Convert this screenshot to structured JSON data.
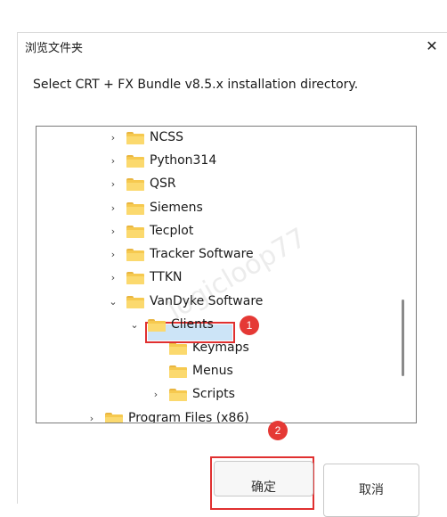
{
  "dialog": {
    "title": "浏览文件夹",
    "close_glyph": "✕",
    "description": "Select CRT + FX Bundle v8.5.x installation directory."
  },
  "tree": {
    "items": [
      {
        "label": "NCSS",
        "chevron": "›"
      },
      {
        "label": "Python314",
        "chevron": "›"
      },
      {
        "label": "QSR",
        "chevron": "›"
      },
      {
        "label": "Siemens",
        "chevron": "›"
      },
      {
        "label": "Tecplot",
        "chevron": "›"
      },
      {
        "label": "Tracker Software",
        "chevron": "›"
      },
      {
        "label": "TTKN",
        "chevron": "›"
      },
      {
        "label": "VanDyke Software",
        "chevron": "⌄"
      },
      {
        "label": "Clients",
        "chevron": "⌄"
      },
      {
        "label": "Keymaps",
        "chevron": ""
      },
      {
        "label": "Menus",
        "chevron": ""
      },
      {
        "label": "Scripts",
        "chevron": "›"
      },
      {
        "label": "Program Files (x86)",
        "chevron": "›"
      }
    ]
  },
  "badges": {
    "first": "1",
    "second": "2"
  },
  "buttons": {
    "ok_label": "确定",
    "cancel_label": "取消"
  },
  "watermark": "logicloop77",
  "colors": {
    "selection": "#cce4f7",
    "highlight_red": "#e03030",
    "folder": "#f6c94f"
  }
}
